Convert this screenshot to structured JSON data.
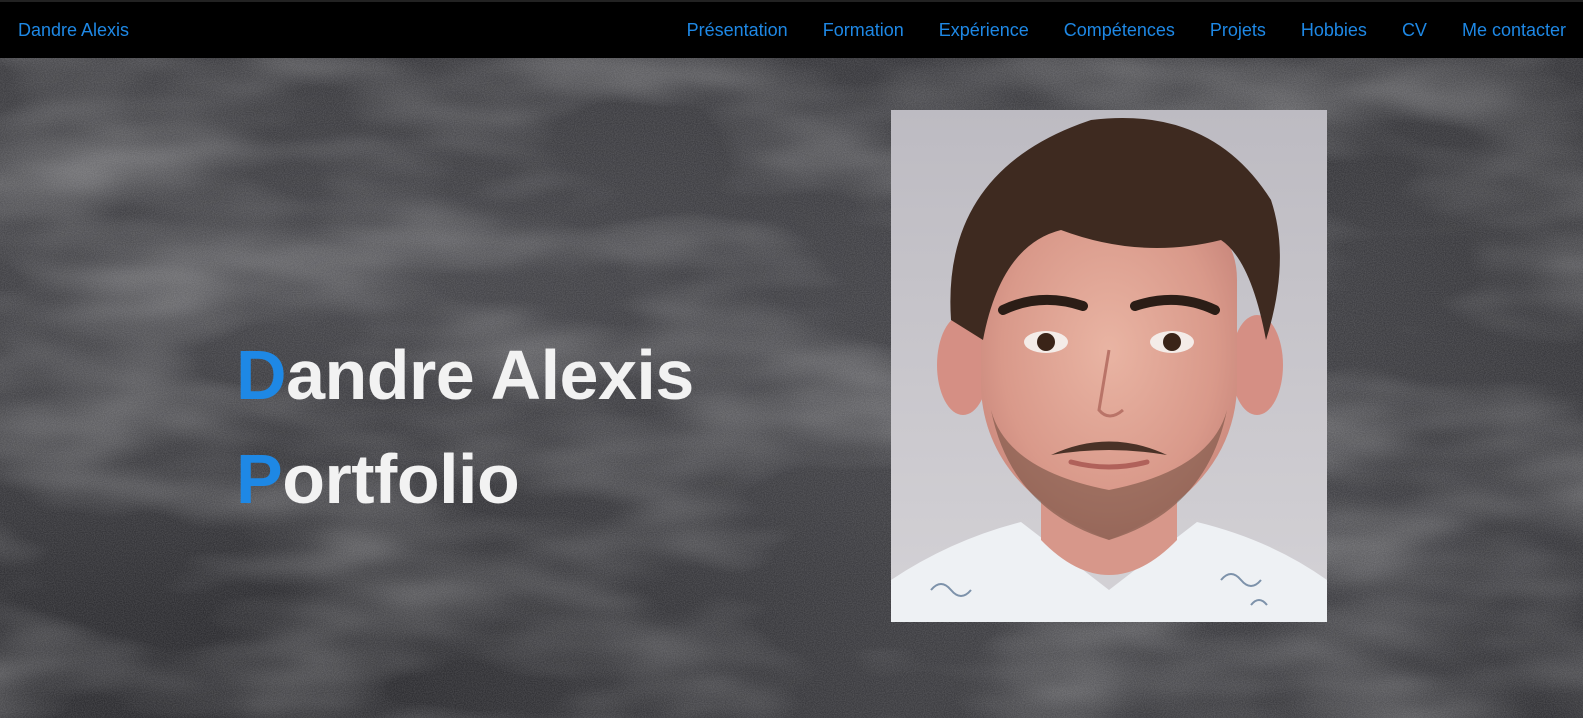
{
  "navbar": {
    "brand": "Dandre Alexis",
    "links": [
      {
        "label": "Présentation"
      },
      {
        "label": "Formation"
      },
      {
        "label": "Expérience"
      },
      {
        "label": "Compétences"
      },
      {
        "label": "Projets"
      },
      {
        "label": "Hobbies"
      },
      {
        "label": "CV"
      },
      {
        "label": "Me contacter"
      }
    ]
  },
  "hero": {
    "title_line1_initial": "D",
    "title_line1_rest": "andre Alexis",
    "title_line2_initial": "P",
    "title_line2_rest": "ortfolio",
    "photo_icon": "portrait-photo"
  },
  "colors": {
    "accent": "#1e88e5",
    "navbar_bg": "#000000",
    "hero_text": "#f2f2f2",
    "chalkboard": "#333337"
  }
}
